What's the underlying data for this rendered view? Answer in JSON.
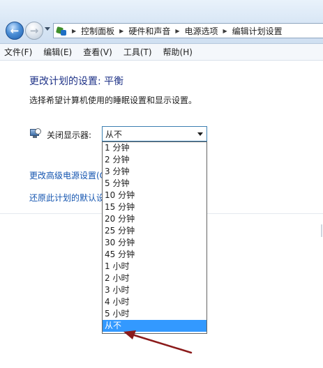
{
  "address_bar": {
    "crumbs": [
      "控制面板",
      "硬件和声音",
      "电源选项",
      "编辑计划设置"
    ]
  },
  "menu": {
    "items": [
      "文件(F)",
      "编辑(E)",
      "查看(V)",
      "工具(T)",
      "帮助(H)"
    ]
  },
  "content": {
    "title": "更改计划的设置: 平衡",
    "description": "选择希望计算机使用的睡眠设置和显示设置。",
    "display_label": "关闭显示器:",
    "display_value": "从不",
    "link_advanced": "更改高级电源设置(C)",
    "link_restore": "还原此计划的默认设置"
  },
  "dropdown": {
    "options": [
      "1 分钟",
      "2 分钟",
      "3 分钟",
      "5 分钟",
      "10 分钟",
      "15 分钟",
      "20 分钟",
      "25 分钟",
      "30 分钟",
      "45 分钟",
      "1 小时",
      "2 小时",
      "3 小时",
      "4 小时",
      "5 小时",
      "从不"
    ],
    "selected": "从不"
  },
  "colors": {
    "title": "#1e3287",
    "link": "#1455b0",
    "selection": "#3399ff",
    "annotation_arrow": "#8b1a1a"
  },
  "icons": {
    "back": "back-arrow-icon",
    "forward": "forward-arrow-icon",
    "control_panel": "control-panel-icon",
    "display": "display-timer-icon"
  }
}
